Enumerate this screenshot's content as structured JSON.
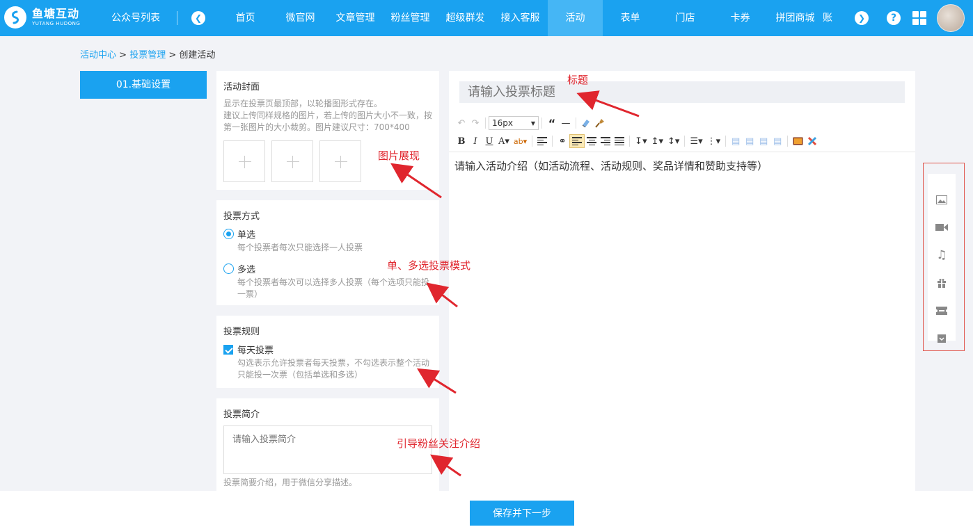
{
  "colors": {
    "primary": "#1aa2f0",
    "nav_active": "#45b6f5",
    "annotation": "#e0262e"
  },
  "logo": {
    "cn": "鱼塘互动",
    "en": "YUTANG HUDONG"
  },
  "topnav": {
    "account_list": "公众号列表",
    "items": [
      "首页",
      "微官网",
      "文章管理",
      "粉丝管理",
      "超级群发",
      "接入客服",
      "活动",
      "表单",
      "门店",
      "卡券",
      "拼团商城",
      "账"
    ],
    "active_index": 6,
    "help": "?"
  },
  "breadcrumb": {
    "l1": "活动中心",
    "sep": ">",
    "l2": "投票管理",
    "current": "创建活动"
  },
  "steps": [
    {
      "label": "01.基础设置"
    }
  ],
  "cover": {
    "title": "活动封面",
    "hint1": "显示在投票页最顶部，以轮播图形式存在。",
    "hint2": "建议上传同样规格的图片，若上传的图片大小不一致，按第一张图片的大小裁剪。图片建议尺寸：700*400"
  },
  "vote_mode": {
    "title": "投票方式",
    "options": [
      {
        "label": "单选",
        "hint": "每个投票者每次只能选择一人投票",
        "checked": true
      },
      {
        "label": "多选",
        "hint": "每个投票者每次可以选择多人投票（每个选项只能投一票）",
        "checked": false
      }
    ]
  },
  "vote_rule": {
    "title": "投票规则",
    "label": "每天投票",
    "hint": "勾选表示允许投票者每天投票，不勾选表示整个活动只能投一次票（包括单选和多选）",
    "checked": true
  },
  "intro": {
    "title": "投票简介",
    "placeholder": "请输入投票简介",
    "hint": "投票简要介绍，用于微信分享描述。"
  },
  "editor": {
    "title_placeholder": "请输入投票标题",
    "font_size": "16px",
    "body_text": "请输入活动介绍（如活动流程、活动规则、奖品详情和赞助支持等）"
  },
  "insert_panel": {
    "icons": [
      "image-icon",
      "video-icon",
      "music-icon",
      "gift-icon",
      "coupon-icon",
      "box-icon"
    ]
  },
  "annotations": {
    "title": "标题",
    "images": "图片展现",
    "mode": "单、多选投票模式",
    "intro": "引导粉丝关注介绍"
  },
  "footer": {
    "save_label": "保存并下一步"
  }
}
